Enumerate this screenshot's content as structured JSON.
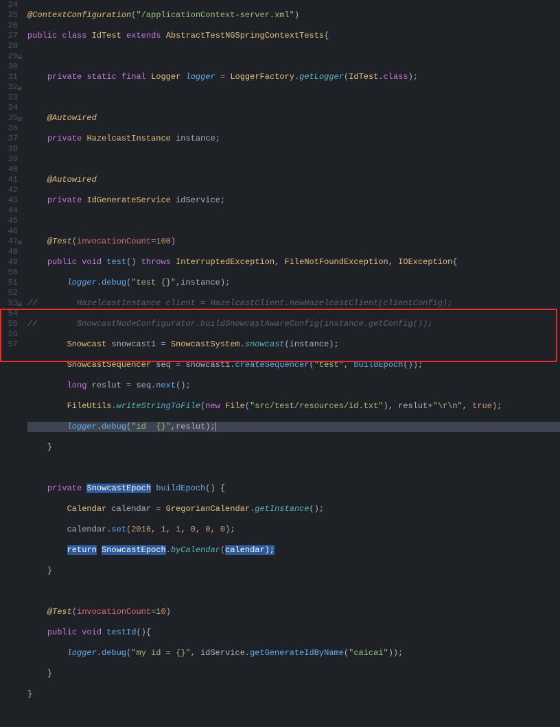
{
  "gutter": {
    "start": 24,
    "end": 57
  },
  "lines": {
    "l24a": "@ContextConfiguration",
    "l24b": "\"/applicationContext-server.xml\"",
    "l25_public": "public",
    "l25_class": "class",
    "l25_name": "IdTest",
    "l25_extends": "extends",
    "l25_super": "AbstractTestNGSpringContextTests",
    "l27_private": "private",
    "l27_static": "static",
    "l27_final": "final",
    "l27_Logger": "Logger",
    "l27_logger": "logger",
    "l27_LoggerFactory": "LoggerFactory",
    "l27_getLogger": "getLogger",
    "l27_IdTest": "IdTest",
    "l27_class2": "class",
    "l29_Autowired": "@Autowired",
    "l30_private": "private",
    "l30_type": "HazelcastInstance",
    "l30_name": "instance",
    "l32_Autowired": "@Autowired",
    "l33_private": "private",
    "l33_type": "IdGenerateService",
    "l33_name": "idService",
    "l35_Test": "@Test",
    "l35_attr": "invocationCount",
    "l35_val": "100",
    "l36_public": "public",
    "l36_void": "void",
    "l36_name": "test",
    "l36_throws": "throws",
    "l36_e1": "InterruptedException",
    "l36_e2": "FileNotFoundException",
    "l36_e3": "IOException",
    "l37_logger": "logger",
    "l37_debug": "debug",
    "l37_str": "\"test {}\"",
    "l37_arg": "instance",
    "l38_comment": "//        HazelcastInstance client = HazelcastClient.newHazelcastClient(clientConfig);",
    "l39_comment": "//        SnowcastNodeConfigurator.buildSnowcastAwareConfig(instance.getConfig());",
    "l40_type": "Snowcast",
    "l40_var": "snowcast1",
    "l40_SnowcastSystem": "SnowcastSystem",
    "l40_snowcast": "snowcast",
    "l40_arg": "instance",
    "l41_type": "SnowcastSequencer",
    "l41_var": "seq",
    "l41_obj": "snowcast1",
    "l41_method": "createSequencer",
    "l41_str": "\"test\"",
    "l41_call": "buildEpoch",
    "l42_long": "long",
    "l42_var": "reslut",
    "l42_seq": "seq",
    "l42_next": "next",
    "l43_FileUtils": "FileUtils",
    "l43_write": "writeStringToFile",
    "l43_new": "new",
    "l43_File": "File",
    "l43_path": "\"src/test/resources/id.txt\"",
    "l43_var": "reslut",
    "l43_suffix": "\"\\r\\n\"",
    "l43_true": "true",
    "l44_logger": "logger",
    "l44_debug": "debug",
    "l44_str": "\"id  {}\"",
    "l44_var": "reslut",
    "l47_private": "private",
    "l47_type": "SnowcastEpoch",
    "l47_name": "buildEpoch",
    "l48_Calendar": "Calendar",
    "l48_var": "calendar",
    "l48_Greg": "GregorianCalendar",
    "l48_getInstance": "getInstance",
    "l49_var": "calendar",
    "l49_set": "set",
    "l49_a": "2016",
    "l49_b": "1",
    "l49_c": "1",
    "l49_d": "0",
    "l49_e": "0",
    "l49_f": "0",
    "l50_return": "return",
    "l50_SnowcastEpoch": "SnowcastEpoch",
    "l50_byCalendar": "byCalendar",
    "l50_arg": "calendar",
    "l53_Test": "@Test",
    "l53_attr": "invocationCount",
    "l53_val": "10",
    "l54_public": "public",
    "l54_void": "void",
    "l54_name": "testId",
    "l55_logger": "logger",
    "l55_debug": "debug",
    "l55_str": "\"my id = {}\"",
    "l55_idService": "idService",
    "l55_method": "getGenerateIdByName",
    "l55_arg": "\"caicai\""
  }
}
